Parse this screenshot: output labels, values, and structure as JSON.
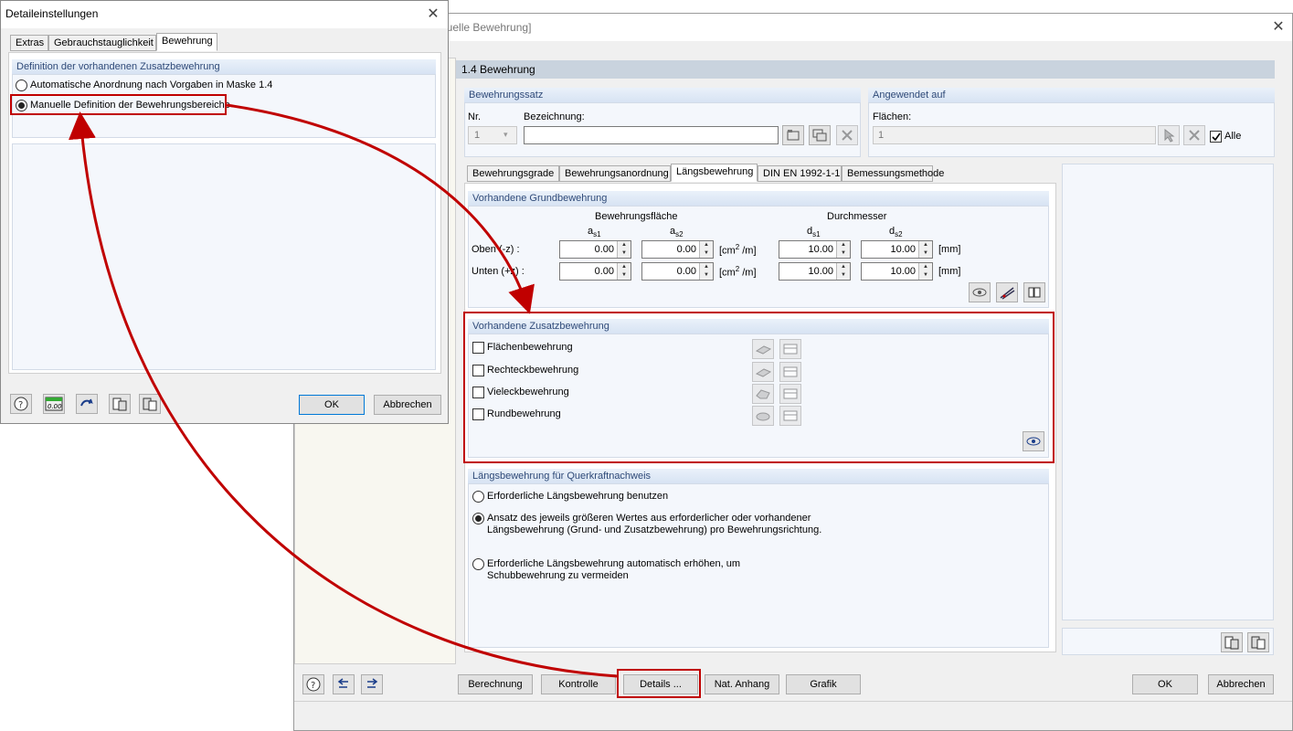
{
  "main": {
    "title": "[Manuelle Bewehrung]",
    "section_title": "1.4 Bewehrung",
    "bewehrungssatz": {
      "title": "Bewehrungssatz",
      "nr_label": "Nr.",
      "nr_value": "1",
      "bez_label": "Bezeichnung:",
      "bez_value": ""
    },
    "angewendet": {
      "title": "Angewendet auf",
      "flaechen_label": "Flächen:",
      "flaechen_value": "1",
      "alle_label": "Alle",
      "alle_checked": true
    },
    "tabs": [
      "Bewehrungsgrade",
      "Bewehrungsanordnung",
      "Längsbewehrung",
      "DIN EN 1992-1-1",
      "Bemessungsmethode"
    ],
    "active_tab": "Längsbewehrung",
    "grund": {
      "title": "Vorhandene Grundbewehrung",
      "flaeche_label": "Bewehrungsfläche",
      "durchmesser_label": "Durchmesser",
      "as1": "a",
      "as1_sub": "s1",
      "as2": "a",
      "as2_sub": "s2",
      "ds1": "d",
      "ds1_sub": "s1",
      "ds2": "d",
      "ds2_sub": "s2",
      "oben_label": "Oben (-z) :",
      "unten_label": "Unten (+z) :",
      "oben": [
        "0.00",
        "0.00",
        "10.00",
        "10.00"
      ],
      "unten": [
        "0.00",
        "0.00",
        "10.00",
        "10.00"
      ],
      "unit_area_pre": "[cm",
      "unit_area_sup": "2",
      "unit_area_post": " /m]",
      "unit_len": "[mm]"
    },
    "zusatz": {
      "title": "Vorhandene Zusatzbewehrung",
      "items": [
        "Flächenbewehrung",
        "Rechteckbewehrung",
        "Vieleckbewehrung",
        "Rundbewehrung"
      ]
    },
    "quer": {
      "title": "Längsbewehrung für Querkraftnachweis",
      "opt1": "Erforderliche Längsbewehrung benutzen",
      "opt2a": "Ansatz des jeweils größeren Wertes aus erforderlicher oder vorhandener",
      "opt2b": "Längsbewehrung (Grund- und Zusatzbewehrung) pro Bewehrungsrichtung.",
      "opt3a": "Erforderliche Längsbewehrung automatisch erhöhen, um",
      "opt3b": "Schubbewehrung zu vermeiden",
      "selected": 2
    },
    "buttons": {
      "berechnung": "Berechnung",
      "kontrolle": "Kontrolle",
      "details": "Details ...",
      "nat_anhang": "Nat. Anhang",
      "grafik": "Grafik",
      "ok": "OK",
      "abbrechen": "Abbrechen"
    }
  },
  "detail": {
    "title": "Detaileinstellungen",
    "tabs": [
      "Extras",
      "Gebrauchstauglichkeit",
      "Bewehrung"
    ],
    "active_tab": "Bewehrung",
    "group_title": "Definition der vorhandenen Zusatzbewehrung",
    "opt_auto": "Automatische Anordnung nach Vorgaben in Maske 1.4",
    "opt_manual": "Manuelle Definition der Bewehrungsbereiche",
    "selected": "manual",
    "icon_decimal": "0.00",
    "ok": "OK",
    "abbrechen": "Abbrechen"
  },
  "colors": {
    "annotation": "#c00000",
    "group_header_text": "#2f4a78",
    "section_bar": "#c9d3de"
  }
}
